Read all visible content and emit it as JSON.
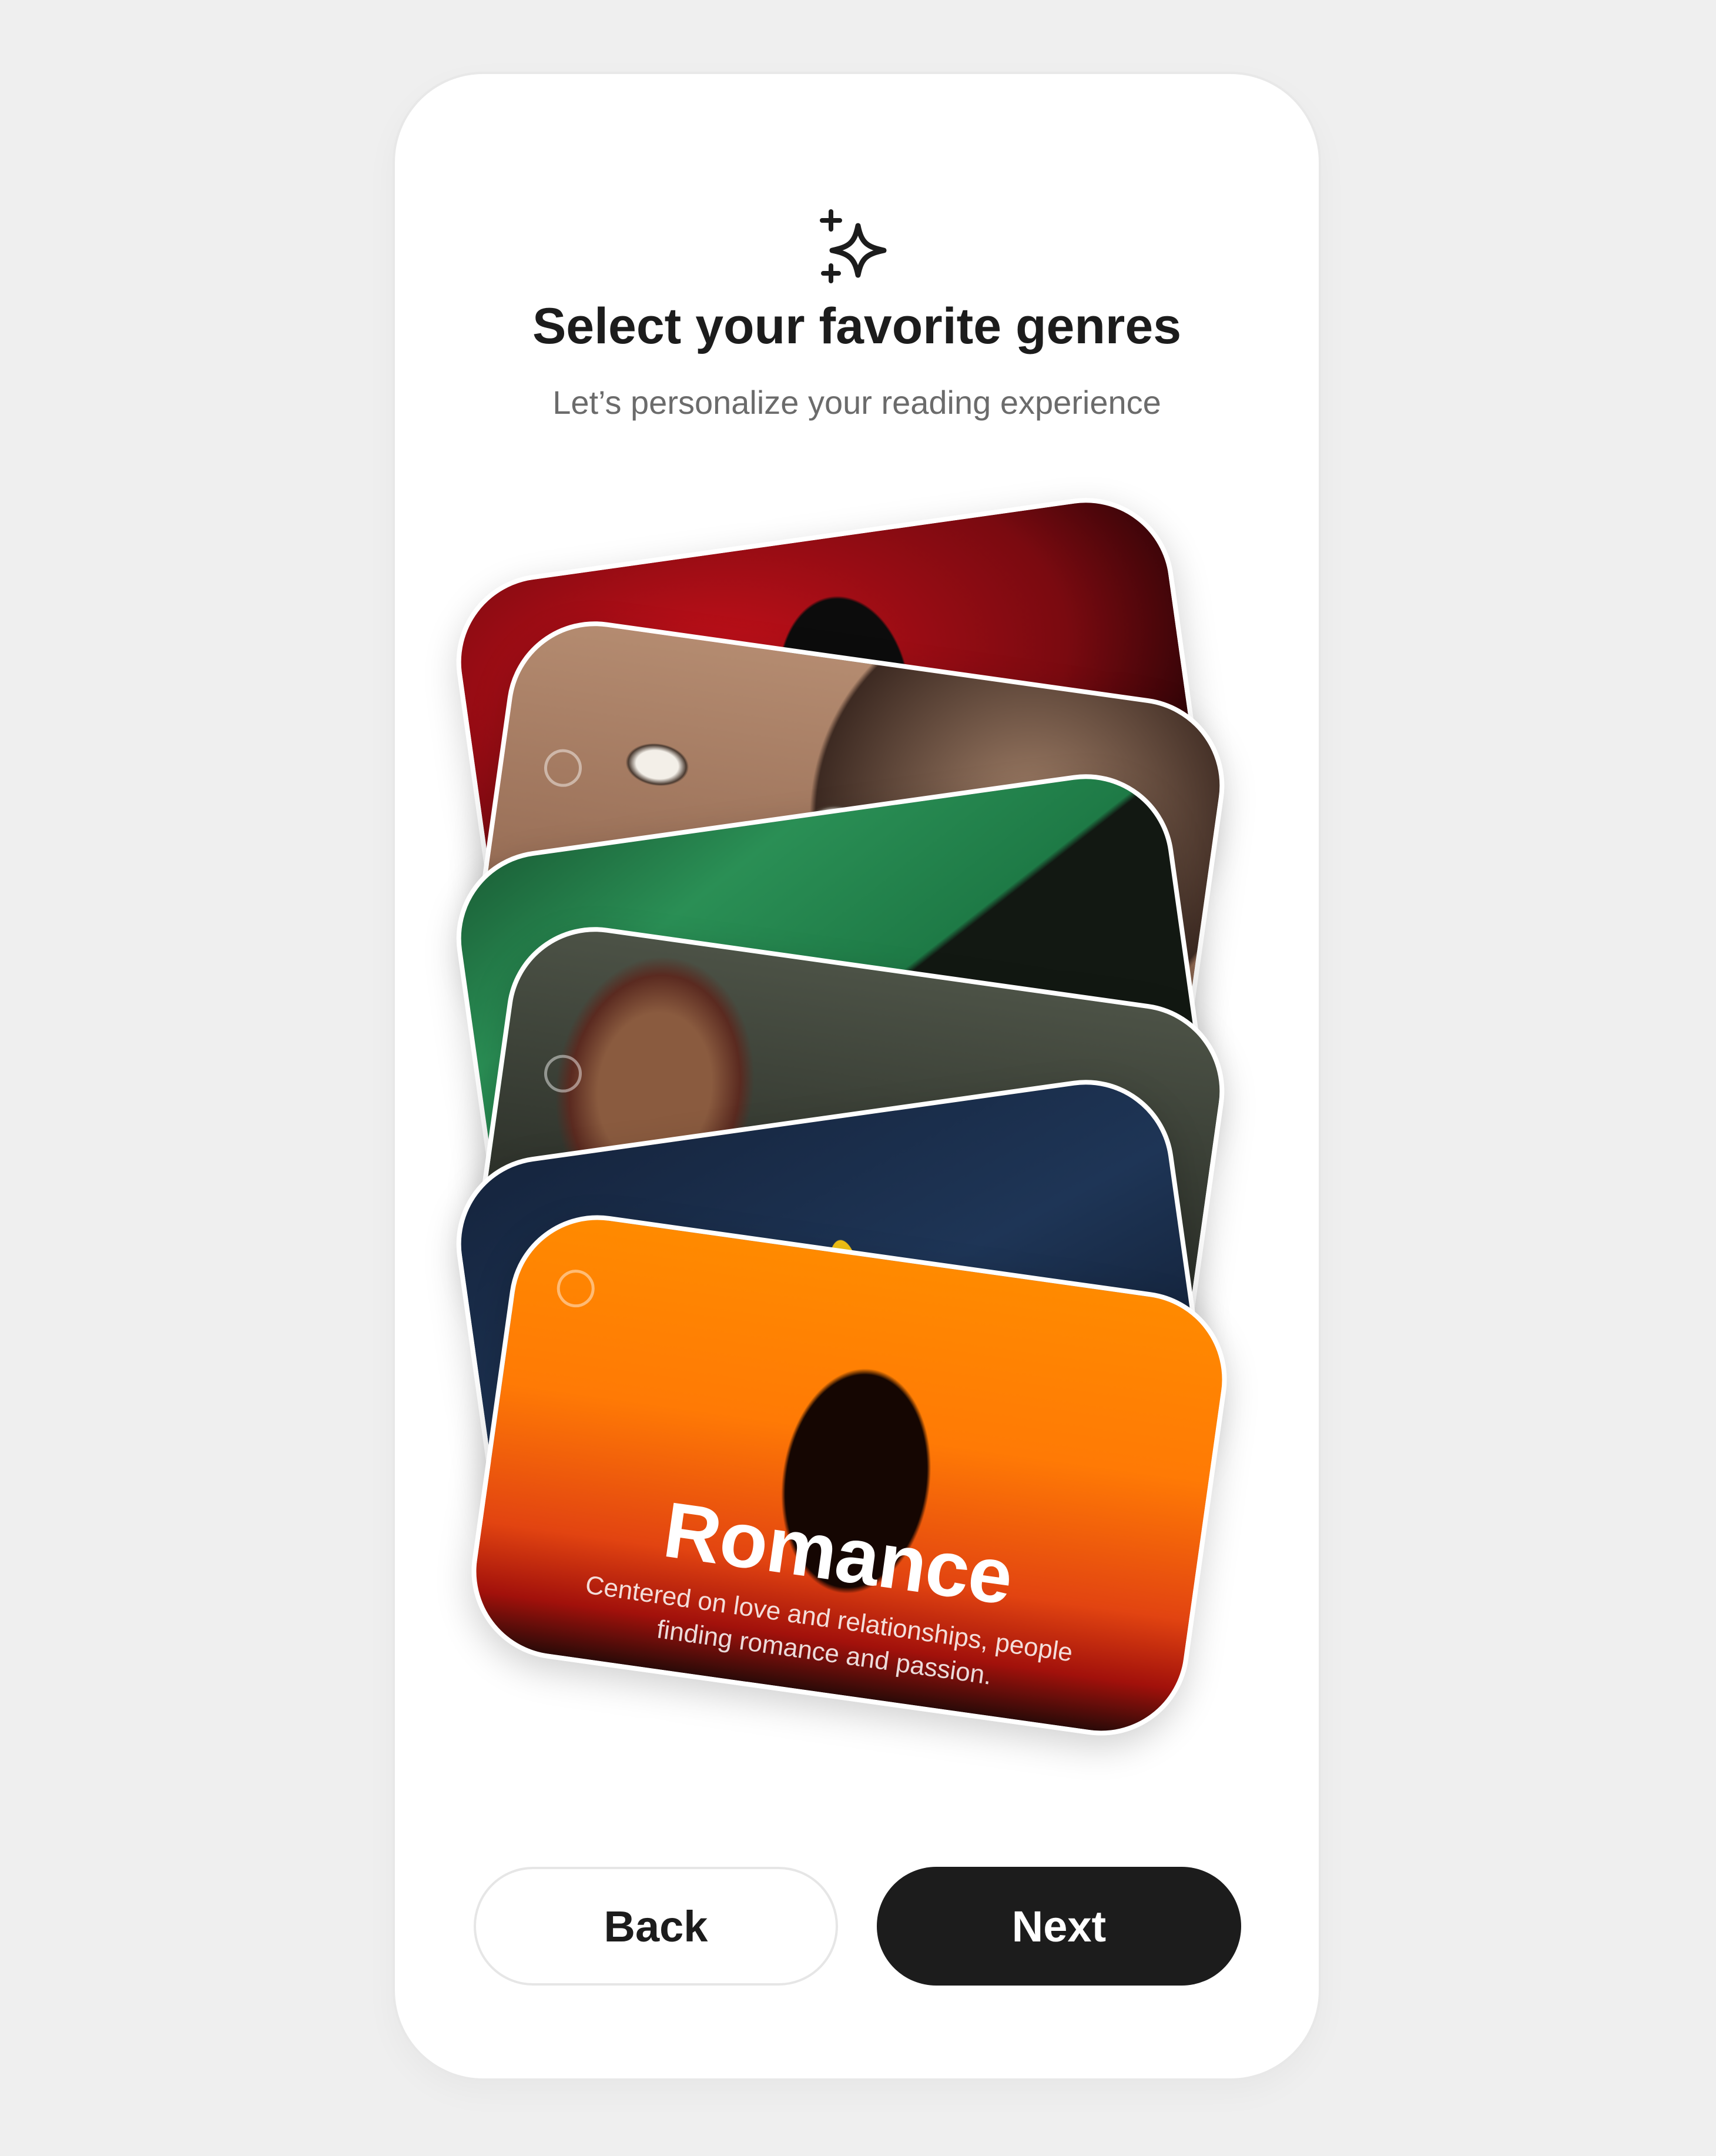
{
  "header": {
    "icon": "sparkles-icon",
    "title": "Select your favorite genres",
    "subtitle": "Let’s personalize your reading experience"
  },
  "genres": [
    {
      "image": "horror-red-silhouette",
      "selected": false
    },
    {
      "image": "thriller-scared-faces",
      "selected": false
    },
    {
      "image": "fantasy-green-book",
      "selected": false
    },
    {
      "image": "comedy-laughing-people",
      "selected": false
    },
    {
      "image": "adventure-ocean-kayak",
      "selected": false
    },
    {
      "name": "Romance",
      "description": "Centered on love and relationships, people finding romance and passion.",
      "image": "romance-sunset-couple",
      "selected": false
    }
  ],
  "footer": {
    "back_label": "Back",
    "next_label": "Next"
  },
  "colors": {
    "background": "#efefef",
    "card_surface": "#ffffff",
    "primary_button": "#1c1c1c",
    "title_text": "#1c1c1c",
    "subtitle_text": "#6b6b6b"
  }
}
